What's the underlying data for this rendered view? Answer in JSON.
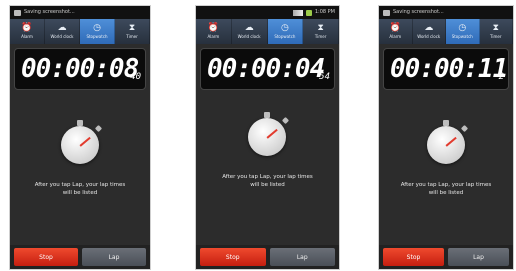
{
  "tabs": [
    {
      "label": "Alarm",
      "icon": "alarm-clock-icon"
    },
    {
      "label": "World clock",
      "icon": "world-clock-icon"
    },
    {
      "label": "Stopwatch",
      "icon": "stopwatch-icon"
    },
    {
      "label": "Timer",
      "icon": "hourglass-icon"
    }
  ],
  "phones": [
    {
      "notification": "Saving screenshot...",
      "time": "00:00:08",
      "centiseconds": "40",
      "clock": ""
    },
    {
      "notification": "",
      "time": "00:00:04",
      "centiseconds": "54",
      "clock": "1:08 PM"
    },
    {
      "notification": "Saving screenshot...",
      "time": "00:00:11",
      "centiseconds": "2",
      "clock": ""
    }
  ],
  "hint_line1": "After you tap Lap, your lap times",
  "hint_line2": "will be listed",
  "buttons": {
    "stop": "Stop",
    "lap": "Lap"
  },
  "colors": {
    "accent": "#2f6bb8",
    "stop": "#d42a17",
    "screen": "#2c2c2c"
  }
}
